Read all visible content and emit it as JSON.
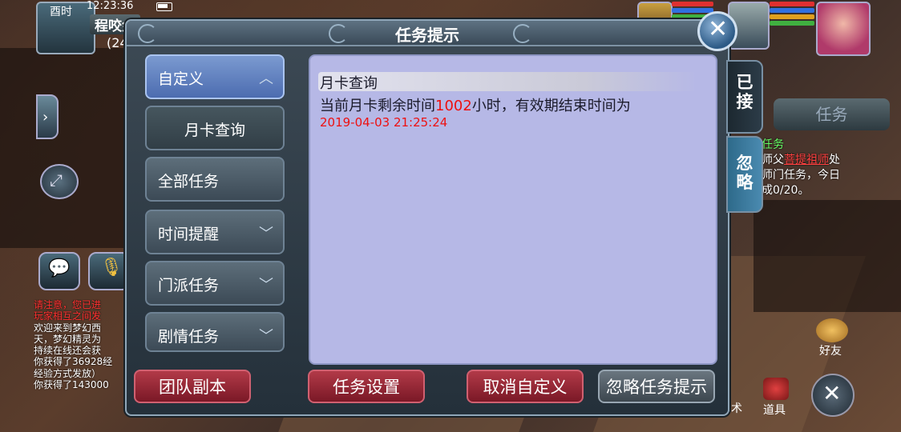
{
  "status": {
    "clock_label": "酉时",
    "time": "12:23:36",
    "player_name": "程咬金",
    "player_level": "(24"
  },
  "dialog": {
    "title": "任务提示",
    "menu": [
      {
        "label": "自定义",
        "state": "expanded"
      },
      {
        "label": "月卡查询",
        "state": "sub-item"
      },
      {
        "label": "全部任务",
        "state": "none"
      },
      {
        "label": "时间提醒",
        "state": "collapsed"
      },
      {
        "label": "门派任务",
        "state": "collapsed"
      },
      {
        "label": "剧情任务",
        "state": "collapsed"
      }
    ],
    "content": {
      "heading": "月卡查询",
      "line1_prefix": "当前月卡剩余时间",
      "remaining_hours": "1002",
      "line1_suffix": "小时，有效期结束时间为",
      "expiry_datetime": "2019-04-03 21:25:24"
    },
    "side_tabs": {
      "accepted": "已接",
      "ignored": "忽略"
    },
    "buttons": {
      "team_dungeon": "团队副本",
      "quest_settings": "任务设置",
      "cancel_custom": "取消自定义",
      "ignore_tips": "忽略任务提示"
    }
  },
  "background": {
    "quest_tab": "任务",
    "quest_tracker": {
      "title": "任务",
      "line1_prefix": "师父",
      "npc": "菩提祖师",
      "line1_suffix": "处",
      "line2": "师门任务，今日",
      "line3": "成0/20。"
    },
    "chat_log": [
      {
        "text": "请注意，您已进",
        "type": "warn"
      },
      {
        "text": "玩家相互之间发",
        "type": "warn"
      },
      {
        "text": "欢迎来到梦幻西",
        "type": "normal"
      },
      {
        "text": "天，梦幻精灵为",
        "type": "normal"
      },
      {
        "text": "持续在线还会获",
        "type": "normal"
      },
      {
        "text": "你获得了36928经",
        "type": "normal"
      },
      {
        "text": "经验方式发放）",
        "type": "normal"
      },
      {
        "text": "你获得了143000",
        "type": "normal"
      }
    ],
    "friends_label": "好友",
    "props_label": "道具",
    "skill_label": "法术"
  },
  "colors": {
    "highlight_red": "#ee1010",
    "content_bg": "#b6b8e6",
    "active_menu": "#6a8ac8",
    "red_button": "#9a2a38"
  }
}
